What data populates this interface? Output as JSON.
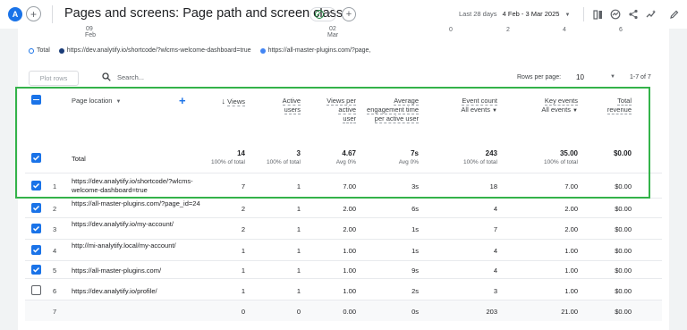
{
  "header": {
    "avatar_letter": "A",
    "title": "Pages and screens: Page path and screen class",
    "date_label": "Last 28 days",
    "date_range": "4 Feb - 3 Mar 2025"
  },
  "chart_remnant": {
    "x_ticks": [
      "Feb",
      "Mar"
    ],
    "x_ticks_top": [
      "09",
      "02"
    ],
    "scale_ticks": [
      "0",
      "2",
      "4",
      "6"
    ]
  },
  "legend": {
    "items": [
      {
        "label": "Total",
        "color": "#1a73e8",
        "hollow": true
      },
      {
        "label": "https://dev.analytify.io/shortcode/?wlcms-welcome-dashboard=true",
        "color": "#1a3c78",
        "hollow": false
      },
      {
        "label": "https://all-master-plugins.com/?page,",
        "color": "#4285f4",
        "hollow": false
      }
    ]
  },
  "toolbar": {
    "plot_rows": "Plot rows",
    "search_placeholder": "Search...",
    "rows_per_page_label": "Rows per page:",
    "rows_per_page_value": "10",
    "pagination": "1-7 of 7"
  },
  "table": {
    "dimension_header": "Page location",
    "columns": [
      {
        "key": "views",
        "label": "Views",
        "sub": "",
        "sort": true
      },
      {
        "key": "active_users",
        "label": "Active users",
        "sub": ""
      },
      {
        "key": "views_per_user",
        "label": "Views per active user",
        "sub": ""
      },
      {
        "key": "avg_engagement",
        "label": "Average engagement time per active user",
        "sub": ""
      },
      {
        "key": "event_count",
        "label": "Event count",
        "sub": "All events"
      },
      {
        "key": "key_events",
        "label": "Key events",
        "sub": "All events"
      },
      {
        "key": "total_revenue",
        "label": "Total revenue",
        "sub": ""
      }
    ],
    "total": {
      "label": "Total",
      "values": [
        "14",
        "3",
        "4.67",
        "7s",
        "243",
        "35.00",
        "$0.00"
      ],
      "subs": [
        "100% of total",
        "100% of total",
        "Avg 0%",
        "Avg 0%",
        "100% of total",
        "100% of total",
        ""
      ]
    },
    "rows": [
      {
        "idx": "1",
        "url": "https://dev.analytify.io/shortcode/?wlcms-welcome-dashboard=true",
        "checked": true,
        "values": [
          "7",
          "1",
          "7.00",
          "3s",
          "18",
          "7.00",
          "$0.00"
        ]
      },
      {
        "idx": "2",
        "url": "https://all-master-plugins.com/?page_id=24",
        "checked": true,
        "values": [
          "2",
          "1",
          "2.00",
          "6s",
          "4",
          "2.00",
          "$0.00"
        ]
      },
      {
        "idx": "3",
        "url": "https://dev.analytify.io/my-account/",
        "checked": true,
        "values": [
          "2",
          "1",
          "2.00",
          "1s",
          "7",
          "2.00",
          "$0.00"
        ]
      },
      {
        "idx": "4",
        "url": "http://mi-analytify.local/my-account/",
        "checked": true,
        "values": [
          "1",
          "1",
          "1.00",
          "1s",
          "4",
          "1.00",
          "$0.00"
        ]
      },
      {
        "idx": "5",
        "url": "https://all-master-plugins.com/",
        "checked": true,
        "values": [
          "1",
          "1",
          "1.00",
          "9s",
          "4",
          "1.00",
          "$0.00"
        ]
      },
      {
        "idx": "6",
        "url": "https://dev.analytify.io/profile/",
        "checked": false,
        "values": [
          "1",
          "1",
          "1.00",
          "2s",
          "3",
          "1.00",
          "$0.00"
        ]
      },
      {
        "idx": "7",
        "url": "",
        "checked": null,
        "values": [
          "0",
          "0",
          "0.00",
          "0s",
          "203",
          "21.00",
          "$0.00"
        ]
      }
    ]
  }
}
